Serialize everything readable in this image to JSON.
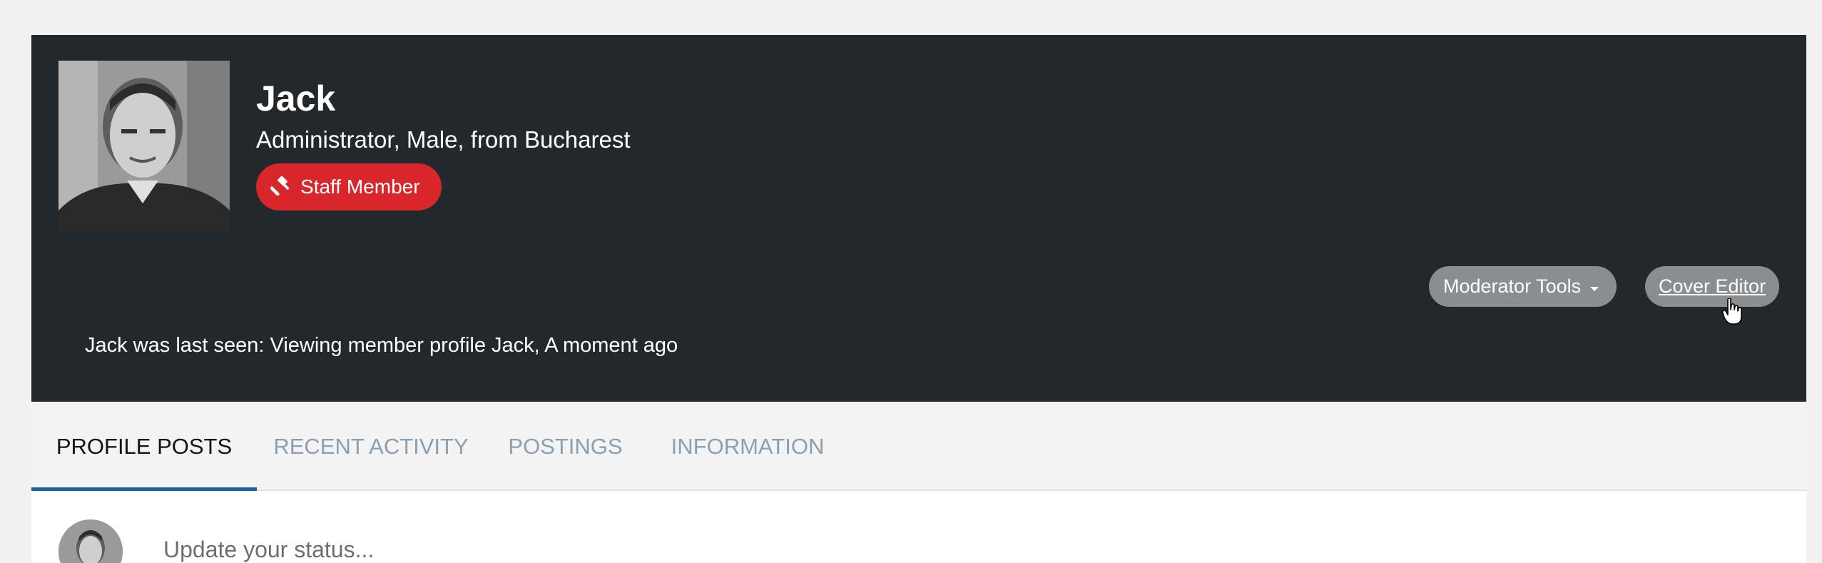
{
  "profile": {
    "name": "Jack",
    "subtitle": "Administrator, Male, from Bucharest",
    "badge": "Staff Member",
    "last_seen": "Jack was last seen: Viewing member profile Jack, A moment ago"
  },
  "actions": {
    "moderator_tools": "Moderator Tools",
    "cover_editor": "Cover Editor"
  },
  "tabs": [
    {
      "label": "PROFILE POSTS",
      "active": true
    },
    {
      "label": "RECENT ACTIVITY",
      "active": false
    },
    {
      "label": "POSTINGS",
      "active": false
    },
    {
      "label": "INFORMATION",
      "active": false
    }
  ],
  "status": {
    "placeholder": "Update your status..."
  },
  "colors": {
    "cover_background": "#23282d",
    "badge_red": "#d9262b",
    "pill_gray": "#8b8e91",
    "active_tab_underline": "#1f5fa8",
    "inactive_tab_text": "#8aa0b0"
  },
  "icons": {
    "badge": "gavel-icon",
    "dropdown": "caret-down-icon",
    "pointer": "hand-pointer-icon"
  }
}
